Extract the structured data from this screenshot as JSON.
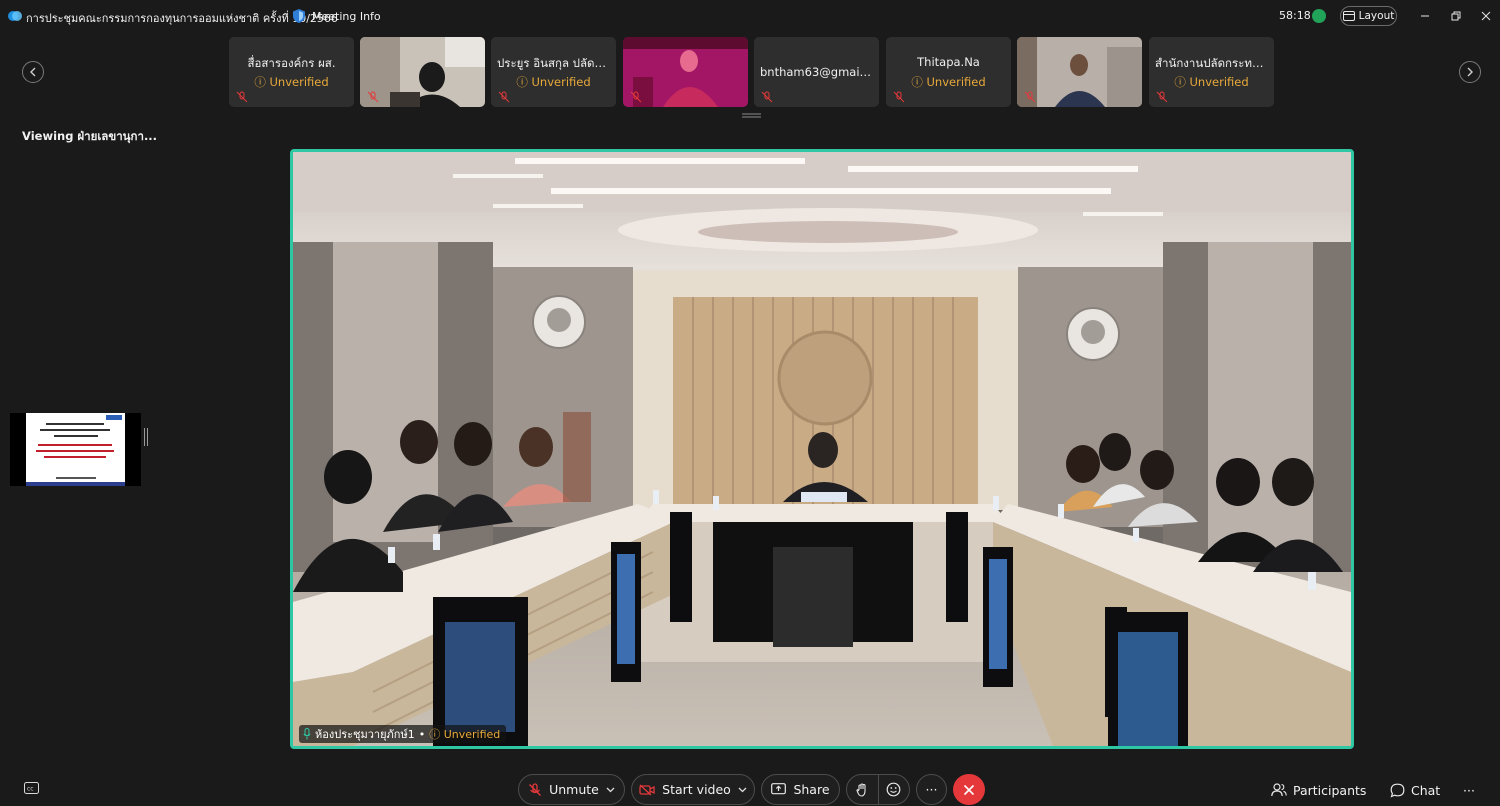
{
  "titlebar": {
    "title": "การประชุมคณะกรรมการกองทุนการออมแห่งชาติ ครั้งที่ 10/2566",
    "meeting_info": "Meeting Info",
    "timer": "58:18",
    "layout_label": "Layout"
  },
  "thumbnails": [
    {
      "name": "สื่อสารองค์กร ผส.",
      "status": "Unverified"
    },
    {
      "name": "",
      "status": ""
    },
    {
      "name": "ประยูร อินสกุล ปลัดกระ...",
      "status": "Unverified"
    },
    {
      "name": "",
      "status": ""
    },
    {
      "name": "bntham63@gmail.com",
      "status": ""
    },
    {
      "name": "Thitapa.Na",
      "status": "Unverified"
    },
    {
      "name": "",
      "status": ""
    },
    {
      "name": "สำนักงานปลัดกระทรวง...",
      "status": "Unverified"
    }
  ],
  "viewing_label": "Viewing ฝ่ายเลขานุกา...",
  "main_video": {
    "participant": "ห้องประชุมวายุภักษ์1",
    "separator": "•",
    "status": "Unverified"
  },
  "toolbar": {
    "unmute": "Unmute",
    "start_video": "Start video",
    "share": "Share",
    "more": "···",
    "participants": "Participants",
    "chat": "Chat",
    "overflow": "···"
  },
  "colors": {
    "active_border": "#2fc7a3",
    "unverified": "#e7a93a",
    "end_call": "#e5383b",
    "background": "#1a1a1a",
    "tile": "#2e2e2e"
  }
}
